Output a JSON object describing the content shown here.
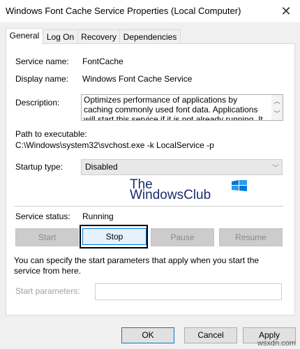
{
  "window": {
    "title": "Windows Font Cache Service Properties (Local Computer)",
    "close_glyph": "✕"
  },
  "tabs": [
    {
      "label": "General",
      "active": true
    },
    {
      "label": "Log On",
      "active": false
    },
    {
      "label": "Recovery",
      "active": false
    },
    {
      "label": "Dependencies",
      "active": false
    }
  ],
  "general": {
    "service_name_label": "Service name:",
    "service_name_value": "FontCache",
    "display_name_label": "Display name:",
    "display_name_value": "Windows Font Cache Service",
    "description_label": "Description:",
    "description_value": "Optimizes performance of applications by caching commonly used font data. Applications will start this service if it is not already running. It can be disabled",
    "path_label": "Path to executable:",
    "path_value": "C:\\Windows\\system32\\svchost.exe -k LocalService -p",
    "startup_label": "Startup type:",
    "startup_value": "Disabled",
    "status_label": "Service status:",
    "status_value": "Running",
    "info_text": "You can specify the start parameters that apply when you start the service from here.",
    "start_params_label": "Start parameters:",
    "start_params_value": ""
  },
  "logo": {
    "line1": "The",
    "line2": "WindowsClub"
  },
  "service_buttons": {
    "start": "Start",
    "stop": "Stop",
    "pause": "Pause",
    "resume": "Resume"
  },
  "footer_buttons": {
    "ok": "OK",
    "cancel": "Cancel",
    "apply": "Apply"
  },
  "watermark": "wsxdn.com",
  "colors": {
    "accent": "#0078d7",
    "logo_text": "#1a2d6b"
  }
}
